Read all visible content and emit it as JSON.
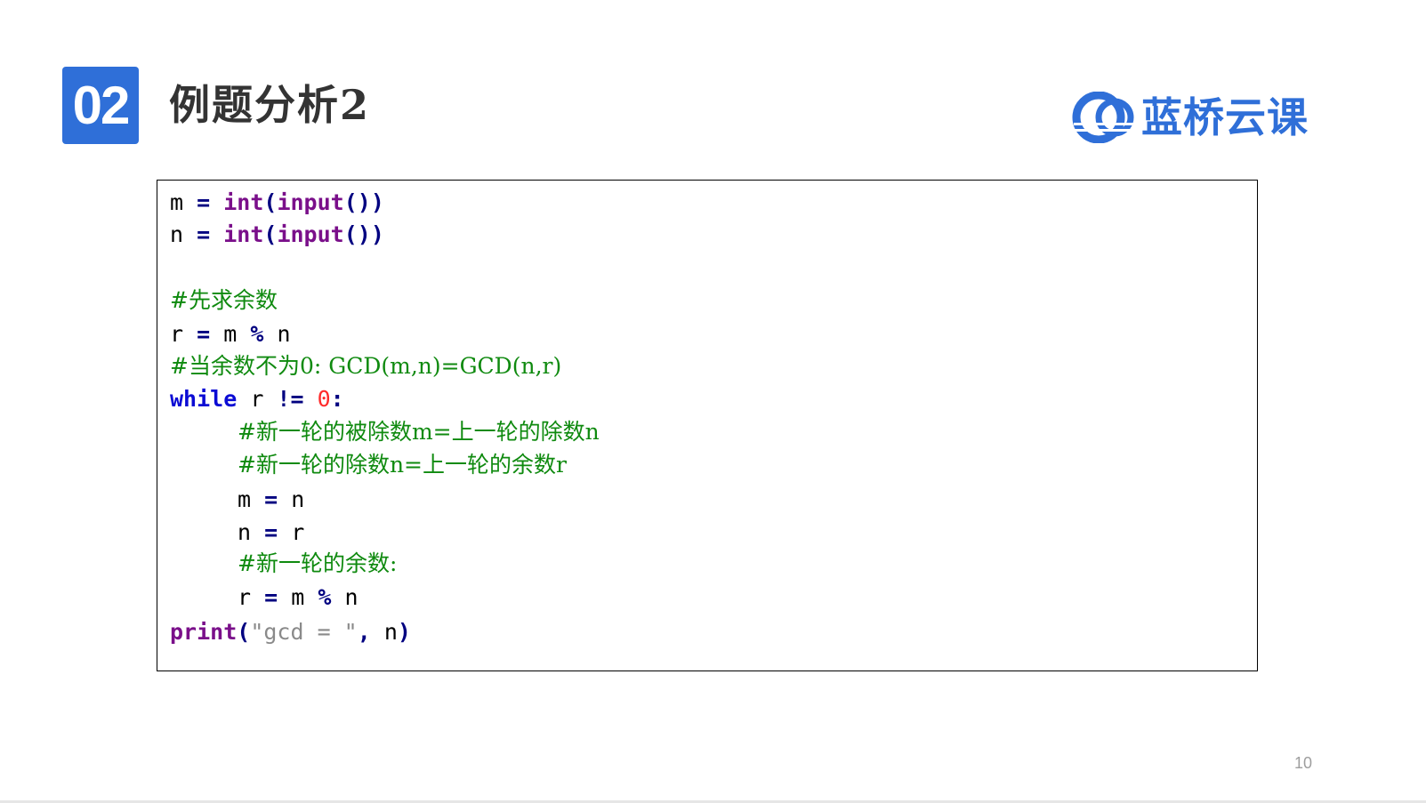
{
  "header": {
    "section_number": "02",
    "title": "例题分析2"
  },
  "logo": {
    "text": "蓝桥云课",
    "brand_color": "#2f6fd8"
  },
  "code": {
    "lines": [
      {
        "indent": 0,
        "tokens": [
          [
            "var",
            "m "
          ],
          [
            "op",
            "="
          ],
          [
            "var",
            " "
          ],
          [
            "func",
            "int"
          ],
          [
            "paren",
            "("
          ],
          [
            "func",
            "input"
          ],
          [
            "paren",
            "())"
          ]
        ]
      },
      {
        "indent": 0,
        "tokens": [
          [
            "var",
            "n "
          ],
          [
            "op",
            "="
          ],
          [
            "var",
            " "
          ],
          [
            "func",
            "int"
          ],
          [
            "paren",
            "("
          ],
          [
            "func",
            "input"
          ],
          [
            "paren",
            "())"
          ]
        ]
      },
      {
        "indent": 0,
        "tokens": []
      },
      {
        "indent": 0,
        "tokens": [
          [
            "comment",
            "#先求余数"
          ]
        ]
      },
      {
        "indent": 0,
        "tokens": [
          [
            "var",
            "r "
          ],
          [
            "op",
            "="
          ],
          [
            "var",
            " m "
          ],
          [
            "op",
            "%"
          ],
          [
            "var",
            " n"
          ]
        ]
      },
      {
        "indent": 0,
        "tokens": [
          [
            "comment",
            "#当余数不为0: GCD(m,n)=GCD(n,r)"
          ]
        ]
      },
      {
        "indent": 0,
        "tokens": [
          [
            "kw",
            "while"
          ],
          [
            "var",
            " r "
          ],
          [
            "op",
            "!="
          ],
          [
            "var",
            " "
          ],
          [
            "num",
            "0"
          ],
          [
            "op",
            ":"
          ]
        ]
      },
      {
        "indent": 1,
        "tokens": [
          [
            "comment",
            "#新一轮的被除数m=上一轮的除数n"
          ]
        ]
      },
      {
        "indent": 1,
        "tokens": [
          [
            "comment",
            "#新一轮的除数n=上一轮的余数r"
          ]
        ]
      },
      {
        "indent": 1,
        "tokens": [
          [
            "var",
            "m "
          ],
          [
            "op",
            "="
          ],
          [
            "var",
            " n"
          ]
        ]
      },
      {
        "indent": 1,
        "tokens": [
          [
            "var",
            "n "
          ],
          [
            "op",
            "="
          ],
          [
            "var",
            " r"
          ]
        ]
      },
      {
        "indent": 1,
        "tokens": [
          [
            "comment",
            "#新一轮的余数:"
          ]
        ]
      },
      {
        "indent": 1,
        "tokens": [
          [
            "var",
            "r "
          ],
          [
            "op",
            "="
          ],
          [
            "var",
            " m "
          ],
          [
            "op",
            "%"
          ],
          [
            "var",
            " n"
          ]
        ]
      },
      {
        "indent": 0,
        "tokens": [
          [
            "func",
            "print"
          ],
          [
            "paren",
            "("
          ],
          [
            "str",
            "\"gcd = \""
          ],
          [
            "op",
            ","
          ],
          [
            "var",
            " n"
          ],
          [
            "paren",
            ")"
          ]
        ]
      }
    ]
  },
  "footer": {
    "page_number": "10"
  }
}
